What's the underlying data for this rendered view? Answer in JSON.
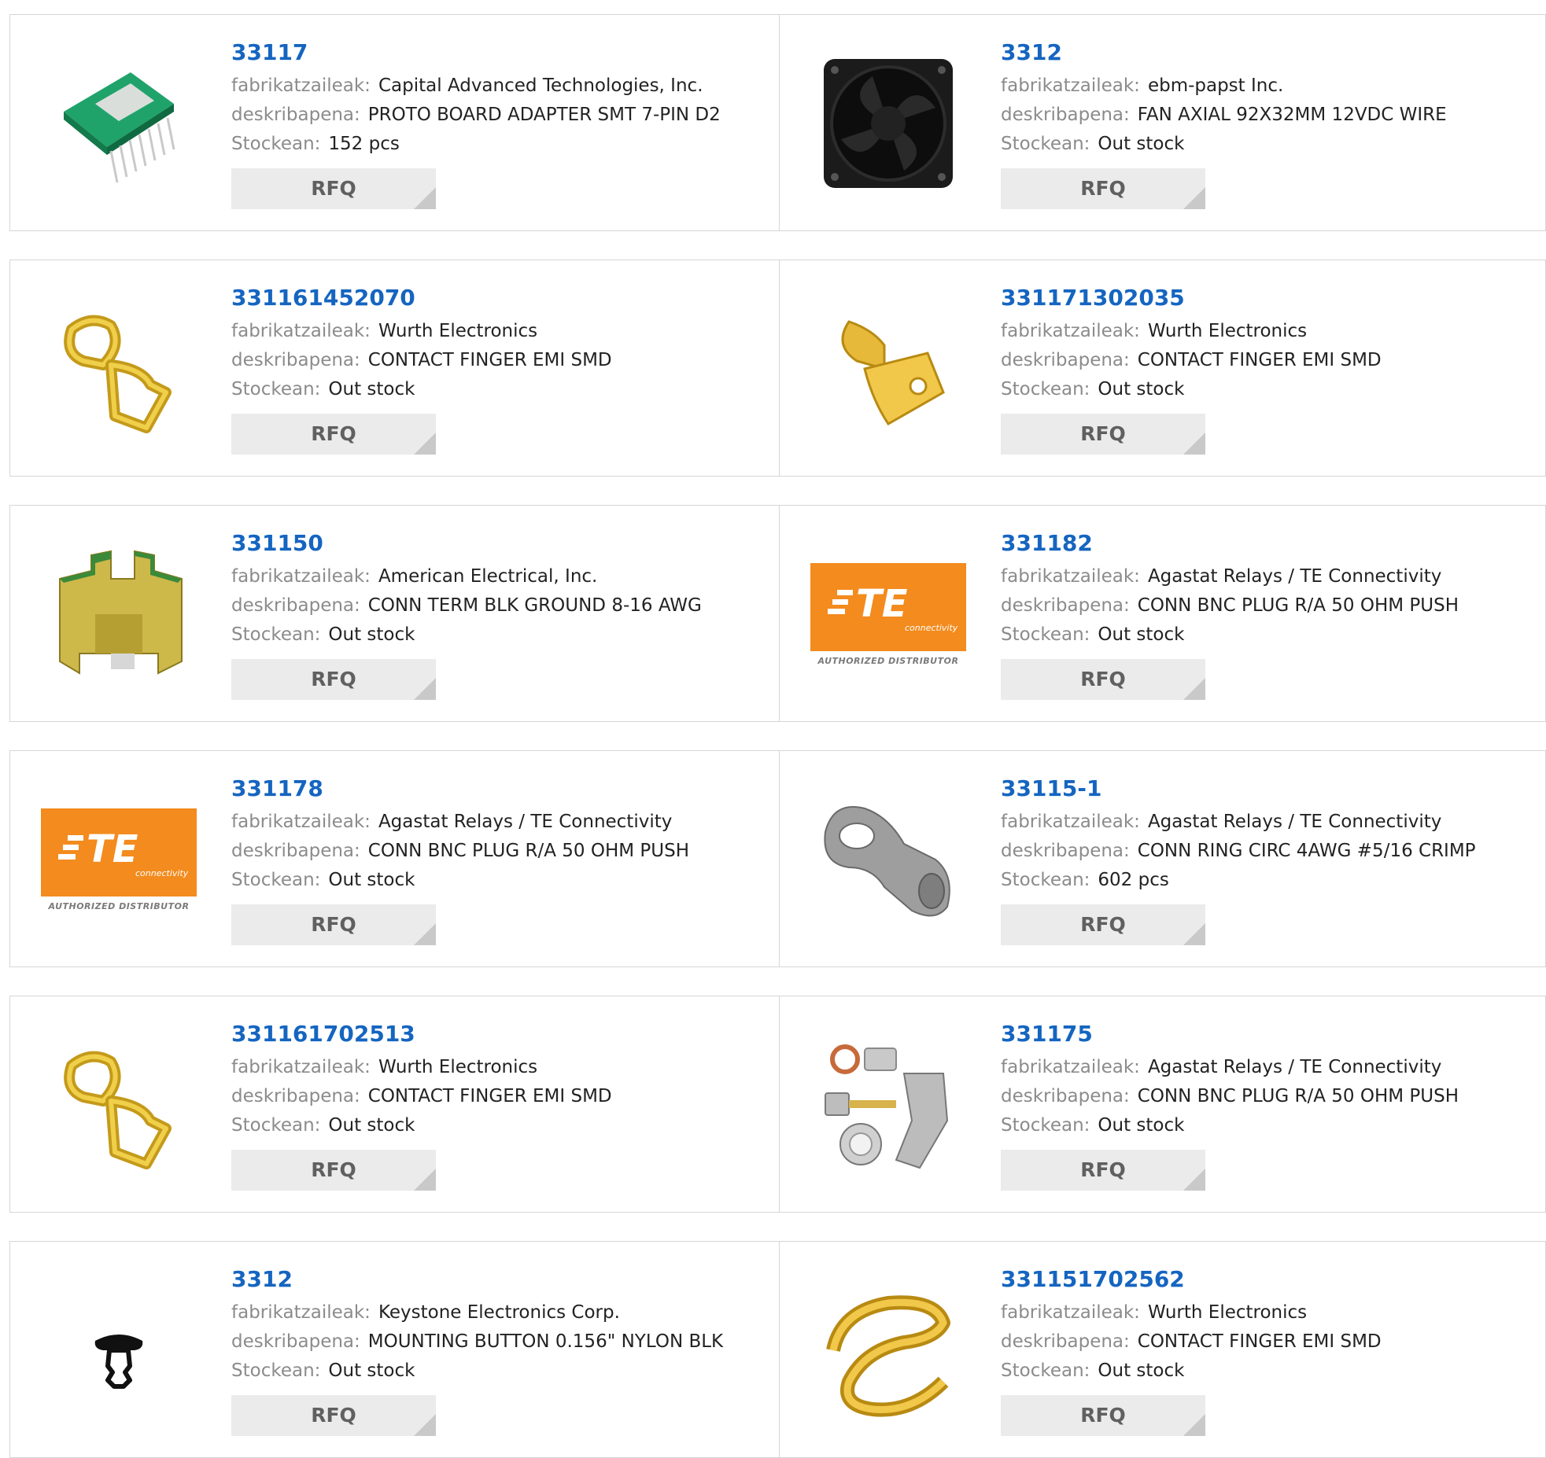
{
  "labels": {
    "manufacturer": "fabrikatzaileak:",
    "description": "deskribapena:",
    "stock": "Stockean:",
    "rfq": "RFQ"
  },
  "colors": {
    "link": "#1565c0",
    "label": "#8b8b8b",
    "button_bg": "#ebebeb",
    "te_orange": "#f38b1e"
  },
  "products": [
    {
      "part": "33117",
      "manufacturer": "Capital Advanced Technologies, Inc.",
      "description": "PROTO BOARD ADAPTER SMT 7-PIN D2",
      "stock": "152 pcs",
      "image": "pcb-adapter-icon"
    },
    {
      "part": "3312",
      "manufacturer": "ebm-papst Inc.",
      "description": "FAN AXIAL 92X32MM 12VDC WIRE",
      "stock": "Out stock",
      "image": "axial-fan-icon"
    },
    {
      "part": "331161452070",
      "manufacturer": "Wurth Electronics",
      "description": "CONTACT FINGER EMI SMD",
      "stock": "Out stock",
      "image": "contact-finger-icon"
    },
    {
      "part": "331171302035",
      "manufacturer": "Wurth Electronics",
      "description": "CONTACT FINGER EMI SMD",
      "stock": "Out stock",
      "image": "contact-finger-icon"
    },
    {
      "part": "331150",
      "manufacturer": "American Electrical, Inc.",
      "description": "CONN TERM BLK GROUND 8-16 AWG",
      "stock": "Out stock",
      "image": "terminal-block-icon"
    },
    {
      "part": "331182",
      "manufacturer": "Agastat Relays / TE Connectivity",
      "description": "CONN BNC PLUG R/A 50 OHM PUSH",
      "stock": "Out stock",
      "image": "te-logo-icon"
    },
    {
      "part": "331178",
      "manufacturer": "Agastat Relays / TE Connectivity",
      "description": "CONN BNC PLUG R/A 50 OHM PUSH",
      "stock": "Out stock",
      "image": "te-logo-icon"
    },
    {
      "part": "33115-1",
      "manufacturer": "Agastat Relays / TE Connectivity",
      "description": "CONN RING CIRC 4AWG #5/16 CRIMP",
      "stock": "602 pcs",
      "image": "ring-terminal-icon"
    },
    {
      "part": "331161702513",
      "manufacturer": "Wurth Electronics",
      "description": "CONTACT FINGER EMI SMD",
      "stock": "Out stock",
      "image": "contact-finger-icon"
    },
    {
      "part": "331175",
      "manufacturer": "Agastat Relays / TE Connectivity",
      "description": "CONN BNC PLUG R/A 50 OHM PUSH",
      "stock": "Out stock",
      "image": "bnc-plug-icon"
    },
    {
      "part": "3312",
      "manufacturer": "Keystone Electronics Corp.",
      "description": "MOUNTING BUTTON 0.156\" NYLON BLK",
      "stock": "Out stock",
      "image": "mounting-button-icon"
    },
    {
      "part": "331151702562",
      "manufacturer": "Wurth Electronics",
      "description": "CONTACT FINGER EMI SMD",
      "stock": "Out stock",
      "image": "contact-finger-icon"
    }
  ],
  "te_logo": {
    "wordmark": "TE",
    "subtitle": "connectivity",
    "caption": "AUTHORIZED DISTRIBUTOR"
  }
}
